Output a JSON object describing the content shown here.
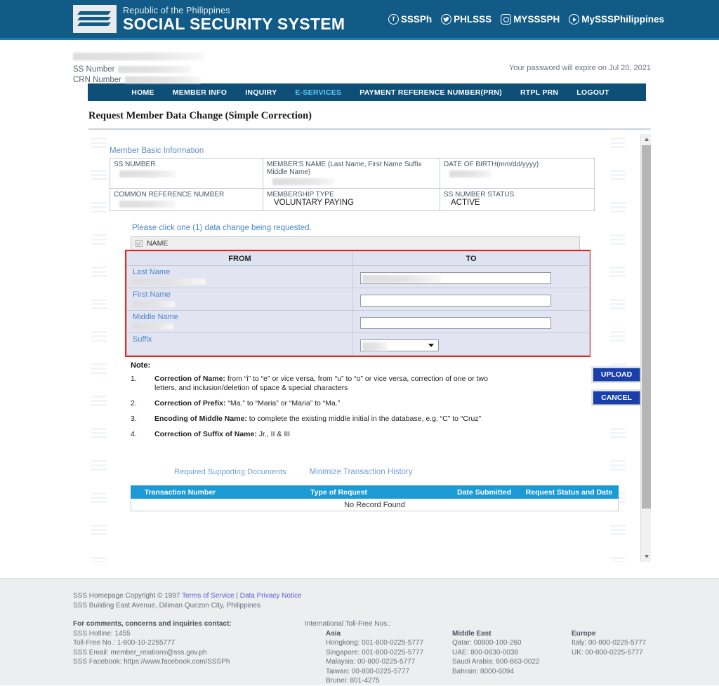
{
  "header": {
    "brand_small": "Republic of the Philippines",
    "brand_large": "SOCIAL SECURITY SYSTEM",
    "socials": [
      {
        "icon": "facebook-icon",
        "glyph": "f",
        "label": "SSSPh"
      },
      {
        "icon": "twitter-icon",
        "glyph": "ᴠ",
        "label": "PHLSSS"
      },
      {
        "icon": "instagram-icon",
        "glyph": "",
        "label": "MYSSSPH"
      },
      {
        "icon": "youtube-icon",
        "glyph": "",
        "label": "MySSSPhilippines"
      }
    ]
  },
  "user": {
    "ss_number_label": "SS Number",
    "crn_number_label": "CRN Number",
    "password_expiry": "Your password will expire on Jul 20, 2021"
  },
  "nav": {
    "items": [
      {
        "label": "HOME",
        "active": false
      },
      {
        "label": "MEMBER INFO",
        "active": false
      },
      {
        "label": "INQUIRY",
        "active": false
      },
      {
        "label": "E-SERVICES",
        "active": true
      },
      {
        "label": "PAYMENT REFERENCE NUMBER(PRN)",
        "active": false
      },
      {
        "label": "RTPL PRN",
        "active": false
      },
      {
        "label": "LOGOUT",
        "active": false
      }
    ]
  },
  "page": {
    "title": "Request Member Data Change (Simple Correction)"
  },
  "member_basic": {
    "section_label": "Member Basic Information",
    "cells": [
      {
        "label": "SS NUMBER",
        "value": ""
      },
      {
        "label": "MEMBER'S NAME (Last Name, First Name Suffix Middle Name)",
        "value": ""
      },
      {
        "label": "DATE OF BIRTH(mm/dd/yyyy)",
        "value": ""
      },
      {
        "label": "COMMON REFERENCE NUMBER",
        "value": ""
      },
      {
        "label": "MEMBERSHIP TYPE",
        "value": "VOLUNTARY PAYING"
      },
      {
        "label": "SS NUMBER STATUS",
        "value": "ACTIVE"
      }
    ]
  },
  "data_change": {
    "instruction": "Please click one (1) data change being requested.",
    "group_label": "NAME",
    "group_checked": true,
    "col_from": "FROM",
    "col_to": "TO",
    "rows": [
      {
        "label": "Last Name",
        "from_redacted": true,
        "control": "text",
        "value_redacted": true
      },
      {
        "label": "First Name",
        "from_redacted": true,
        "control": "text",
        "value_redacted": false
      },
      {
        "label": "Middle Name",
        "from_redacted": true,
        "control": "text",
        "value_redacted": false
      },
      {
        "label": "Suffix",
        "from_redacted": false,
        "control": "select",
        "value_redacted": true
      }
    ],
    "highlight_color": "#ee2222"
  },
  "notes": {
    "title": "Note:",
    "items": [
      {
        "num": "1.",
        "bold": "Correction of Name:",
        "text": " from “i” to “e” or vice versa, from “u” to “o” or vice versa, correction of one or two letters, and inclusion/deletion of space & special characters"
      },
      {
        "num": "2.",
        "bold": "Correction of Prefix:",
        "text": " “Ma.” to “Maria” or “Maria” to “Ma.”"
      },
      {
        "num": "3.",
        "bold": "Encoding of Middle Name:",
        "text": " to complete the existing middle initial in the database, e.g. “C” to “Cruz”"
      },
      {
        "num": "4.",
        "bold": "Correction of Suffix of Name:",
        "text": " Jr., II & III"
      }
    ]
  },
  "actions": {
    "upload_label": "UPLOAD",
    "cancel_label": "CANCEL"
  },
  "links": {
    "required_documents": "Required Supporting Documents",
    "minimize_history": "Minimize Transaction History"
  },
  "history": {
    "headers": [
      "Transaction Number",
      "Type of Request",
      "Date Submitted",
      "Request Status and Date"
    ],
    "empty_message": "No Record Found"
  },
  "footer": {
    "copyright": "SSS Homepage Copyright © 1997",
    "terms_link": "Terms of Service",
    "separator": "|",
    "privacy_link": "Data Privacy Notice",
    "address": "SSS Building East Avenue, Diliman Quezon City, Philippines",
    "contact_heading": "For comments, concerns and inquiries contact:",
    "contact_lines": [
      "SSS Hotline: 1455",
      "Toll-Free No.: 1-800-10-2255777",
      "SSS Email: member_relations@sss.gov.ph",
      "SSS Facebook: https://www.facebook.com/SSSPh"
    ],
    "intl_heading": "International Toll-Free Nos.:",
    "regions": [
      {
        "name": "Asia",
        "entries": [
          "Hongkong: 001-800-0225-5777",
          "Singapore: 001-800-0225-5777",
          "Malaysia: 00-800-0225-5777",
          "Taiwan: 00-800-0225-5777",
          "Brunei: 801-4275"
        ]
      },
      {
        "name": "Middle East",
        "entries": [
          "Qatar: 00800-100-260",
          "UAE: 800-0630-0038",
          "Saudi Arabia: 800-863-0022",
          "Bahrain: 8000-6094"
        ]
      },
      {
        "name": "Europe",
        "entries": [
          "Italy: 00-800-0225-5777",
          "UK: 00-800-0225-5777"
        ]
      }
    ]
  },
  "colors": {
    "header_blue": "#115b86",
    "nav_blue": "#0e4f77",
    "accent_cyan": "#5ec8f7",
    "link_blue": "#4a86c8",
    "button_blue": "#1a3faa",
    "table_header_blue": "#1b9ad6",
    "highlight_red": "#ee2222"
  }
}
